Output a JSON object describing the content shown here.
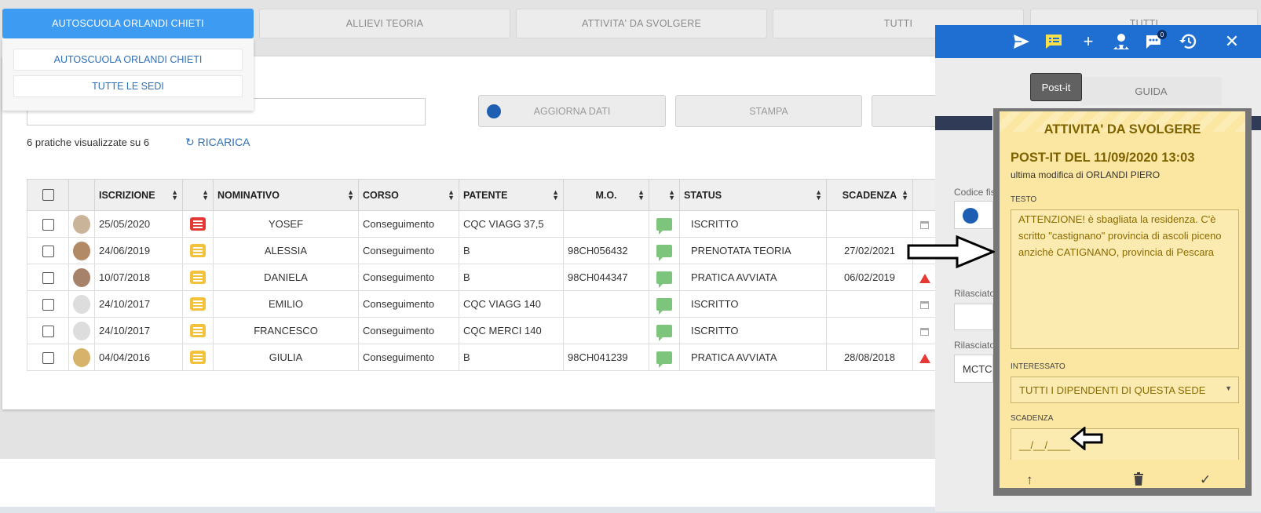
{
  "tabs": [
    {
      "label": "AUTOSCUOLA ORLANDI CHIETI",
      "active": true
    },
    {
      "label": "ALLIEVI TEORIA"
    },
    {
      "label": "ATTIVITA' DA SVOLGERE"
    },
    {
      "label": "TUTTI"
    },
    {
      "label": "TUTTI"
    }
  ],
  "sede_dropdown": {
    "items": [
      "AUTOSCUOLA ORLANDI CHIETI",
      "TUTTE LE SEDI"
    ]
  },
  "toolbar": {
    "aggiorna_label": "AGGIORNA DATI",
    "stampa_label": "STAMPA"
  },
  "list_info": {
    "count_text": "6 pratiche visualizzate su 6",
    "reload_label": "RICARICA"
  },
  "table": {
    "columns": [
      "ISCRIZIONE",
      "NOMINATIVO",
      "CORSO",
      "PATENTE",
      "M.O.",
      "STATUS",
      "SCADENZA"
    ],
    "rows": [
      {
        "iscrizione": "25/05/2020",
        "note": "red",
        "nominativo": "YOSEF",
        "corso": "Conseguimento",
        "patente": "CQC VIAGG 37,5",
        "mo": "",
        "status": "ISCRITTO",
        "scadenza": "",
        "flag": "calendar"
      },
      {
        "iscrizione": "24/06/2019",
        "note": "yellow",
        "nominativo": "ALESSIA",
        "corso": "Conseguimento",
        "patente": "B",
        "mo": "98CH056432",
        "status": "PRENOTATA TEORIA",
        "scadenza": "27/02/2021",
        "flag": "calendar-green"
      },
      {
        "iscrizione": "10/07/2018",
        "note": "yellow",
        "nominativo": "DANIELA",
        "corso": "Conseguimento",
        "patente": "B",
        "mo": "98CH044347",
        "status": "PRATICA AVVIATA",
        "scadenza": "06/02/2019",
        "flag": "warning"
      },
      {
        "iscrizione": "24/10/2017",
        "note": "yellow",
        "nominativo": "EMILIO",
        "corso": "Conseguimento",
        "patente": "CQC VIAGG 140",
        "mo": "",
        "status": "ISCRITTO",
        "scadenza": "",
        "flag": "calendar"
      },
      {
        "iscrizione": "24/10/2017",
        "note": "yellow",
        "nominativo": "FRANCESCO",
        "corso": "Conseguimento",
        "patente": "CQC MERCI 140",
        "mo": "",
        "status": "ISCRITTO",
        "scadenza": "",
        "flag": "calendar"
      },
      {
        "iscrizione": "04/04/2016",
        "note": "yellow",
        "nominativo": "GIULIA",
        "corso": "Conseguimento",
        "patente": "B",
        "mo": "98CH041239",
        "status": "PRATICA AVVIATA",
        "scadenza": "28/08/2018",
        "flag": "warning"
      }
    ]
  },
  "side_panel": {
    "tooltip": "Post-it",
    "guida_tab": "GUIDA",
    "codice_label": "Codice fis",
    "rilasciato_label_1": "Rilasciato",
    "rilasciato_label_2": "Rilasciato",
    "rilasciato_value": "MCTC",
    "notification_count": "0"
  },
  "postit": {
    "title": "ATTIVITA' DA SVOLGERE",
    "subtitle": "POST-IT DEL 11/09/2020 13:03",
    "modified": "ultima modifica di ORLANDI PIERO",
    "testo_label": "TESTO",
    "testo": "ATTENZIONE! è sbagliata la residenza. C'è scritto \"castignano\" provincia di ascoli piceno anzichè CATIGNANO, provincia di Pescara",
    "interessato_label": "INTERESSATO",
    "interessato_value": "TUTTI I DIPENDENTI DI QUESTA SEDE",
    "scadenza_label": "SCADENZA",
    "scadenza_placeholder": "__/__/____"
  },
  "colors": {
    "accent": "#3d9cf1",
    "topbar": "#1e6fd1",
    "postit": "#fbe7a2",
    "note_yellow": "#f4c13b",
    "note_red": "#e53935",
    "chat_green": "#7dc47d"
  }
}
